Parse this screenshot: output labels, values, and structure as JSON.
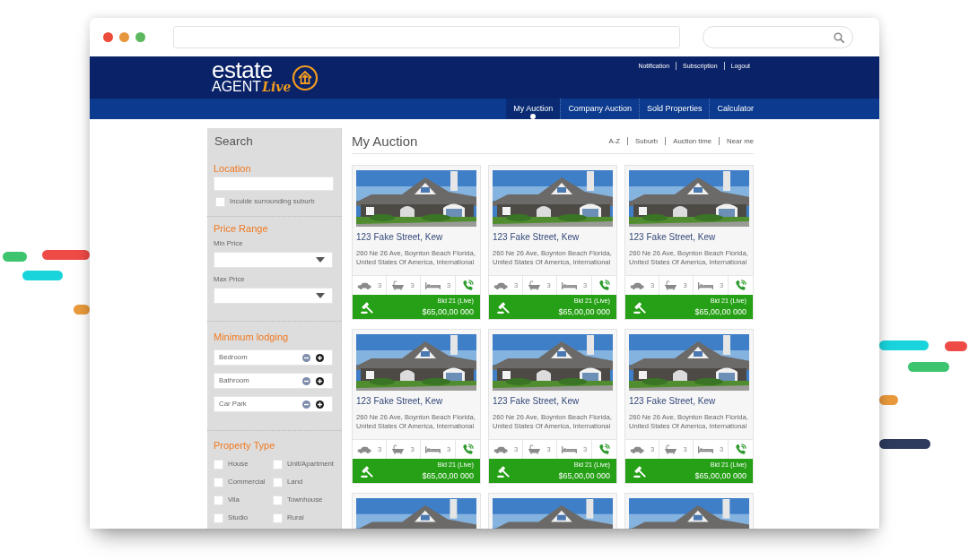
{
  "header": {
    "logo": {
      "word_1": "estate",
      "word_2": "AGENT",
      "word_3": "Live"
    },
    "links": [
      "Notification",
      "Subscription",
      "Logout"
    ]
  },
  "nav": [
    {
      "label": "My Auction",
      "selected": true
    },
    {
      "label": "Company Auction",
      "selected": false
    },
    {
      "label": "Sold Properties",
      "selected": false
    },
    {
      "label": "Calculator",
      "selected": false
    }
  ],
  "sidebar": {
    "title": "Search",
    "sections": [
      {
        "kind": "location",
        "heading": "Location",
        "checkbox": {
          "label": "Inculde surrounding suburb",
          "checked": false
        }
      },
      {
        "kind": "price",
        "heading": "Price Range",
        "selects": [
          {
            "label": "Min Price"
          },
          {
            "label": "Max Price"
          }
        ]
      },
      {
        "kind": "counters",
        "heading": "Minimum lodging",
        "counters": [
          {
            "label": "Bedroom"
          },
          {
            "label": "Bathroom"
          },
          {
            "label": "Car Park"
          }
        ]
      },
      {
        "kind": "checklist",
        "heading": "Property Type",
        "options": [
          {
            "label": "House",
            "checked": false
          },
          {
            "label": "Unit/Apartment",
            "checked": false
          },
          {
            "label": "Commercial",
            "checked": false
          },
          {
            "label": "Land",
            "checked": false
          },
          {
            "label": "Vila",
            "checked": false
          },
          {
            "label": "Townhouse",
            "checked": false
          },
          {
            "label": "Studio",
            "checked": false
          },
          {
            "label": "Rural",
            "checked": false
          }
        ]
      }
    ]
  },
  "main": {
    "title": "My Auction",
    "sort_links": [
      "A-Z",
      "Suburb",
      "Auction time",
      "Near me"
    ],
    "listings": [
      {
        "kind": "full",
        "title": "123 Fake Street, Kew",
        "address_lines": [
          "260 Ne 26 Ave, Boynton Beach Florida,",
          "United States Of America, International"
        ],
        "features": [
          {
            "kind": "car",
            "count": "3"
          },
          {
            "kind": "bath",
            "count": "3"
          },
          {
            "kind": "bed",
            "count": "3"
          }
        ],
        "bid": "Bid 21 (Live)",
        "price": "$65,00,00 000"
      },
      {
        "kind": "full",
        "title": "123 Fake Street, Kew",
        "address_lines": [
          "260 Ne 26 Ave, Boynton Beach Florida,",
          "United States Of America, International"
        ],
        "features": [
          {
            "kind": "car",
            "count": "3"
          },
          {
            "kind": "bath",
            "count": "3"
          },
          {
            "kind": "bed",
            "count": "3"
          }
        ],
        "bid": "Bid 21 (Live)",
        "price": "$65,00,00 000"
      },
      {
        "kind": "full",
        "title": "123 Fake Street, Kew",
        "address_lines": [
          "260 Ne 26 Ave, Boynton Beach Florida,",
          "United States Of America, International"
        ],
        "features": [
          {
            "kind": "car",
            "count": "3"
          },
          {
            "kind": "bath",
            "count": "3"
          },
          {
            "kind": "bed",
            "count": "3"
          }
        ],
        "bid": "Bid 21 (Live)",
        "price": "$65,00,00 000"
      },
      {
        "kind": "full",
        "title": "123 Fake Street, Kew",
        "address_lines": [
          "260 Ne 26 Ave, Boynton Beach Florida,",
          "United States Of America, International"
        ],
        "features": [
          {
            "kind": "car",
            "count": "3"
          },
          {
            "kind": "bath",
            "count": "3"
          },
          {
            "kind": "bed",
            "count": "3"
          }
        ],
        "bid": "Bid 21 (Live)",
        "price": "$65,00,00 000"
      },
      {
        "kind": "full",
        "title": "123 Fake Street, Kew",
        "address_lines": [
          "260 Ne 26 Ave, Boynton Beach Florida,",
          "United States Of America, International"
        ],
        "features": [
          {
            "kind": "car",
            "count": "3"
          },
          {
            "kind": "bath",
            "count": "3"
          },
          {
            "kind": "bed",
            "count": "3"
          }
        ],
        "bid": "Bid 21 (Live)",
        "price": "$65,00,00 000"
      },
      {
        "kind": "full",
        "title": "123 Fake Street, Kew",
        "address_lines": [
          "260 Ne 26 Ave, Boynton Beach Florida,",
          "United States Of America, International"
        ],
        "features": [
          {
            "kind": "car",
            "count": "3"
          },
          {
            "kind": "bath",
            "count": "3"
          },
          {
            "kind": "bed",
            "count": "3"
          }
        ],
        "bid": "Bid 21 (Live)",
        "price": "$65,00,00 000"
      },
      {
        "kind": "clipped"
      },
      {
        "kind": "clipped"
      },
      {
        "kind": "clipped"
      }
    ]
  }
}
